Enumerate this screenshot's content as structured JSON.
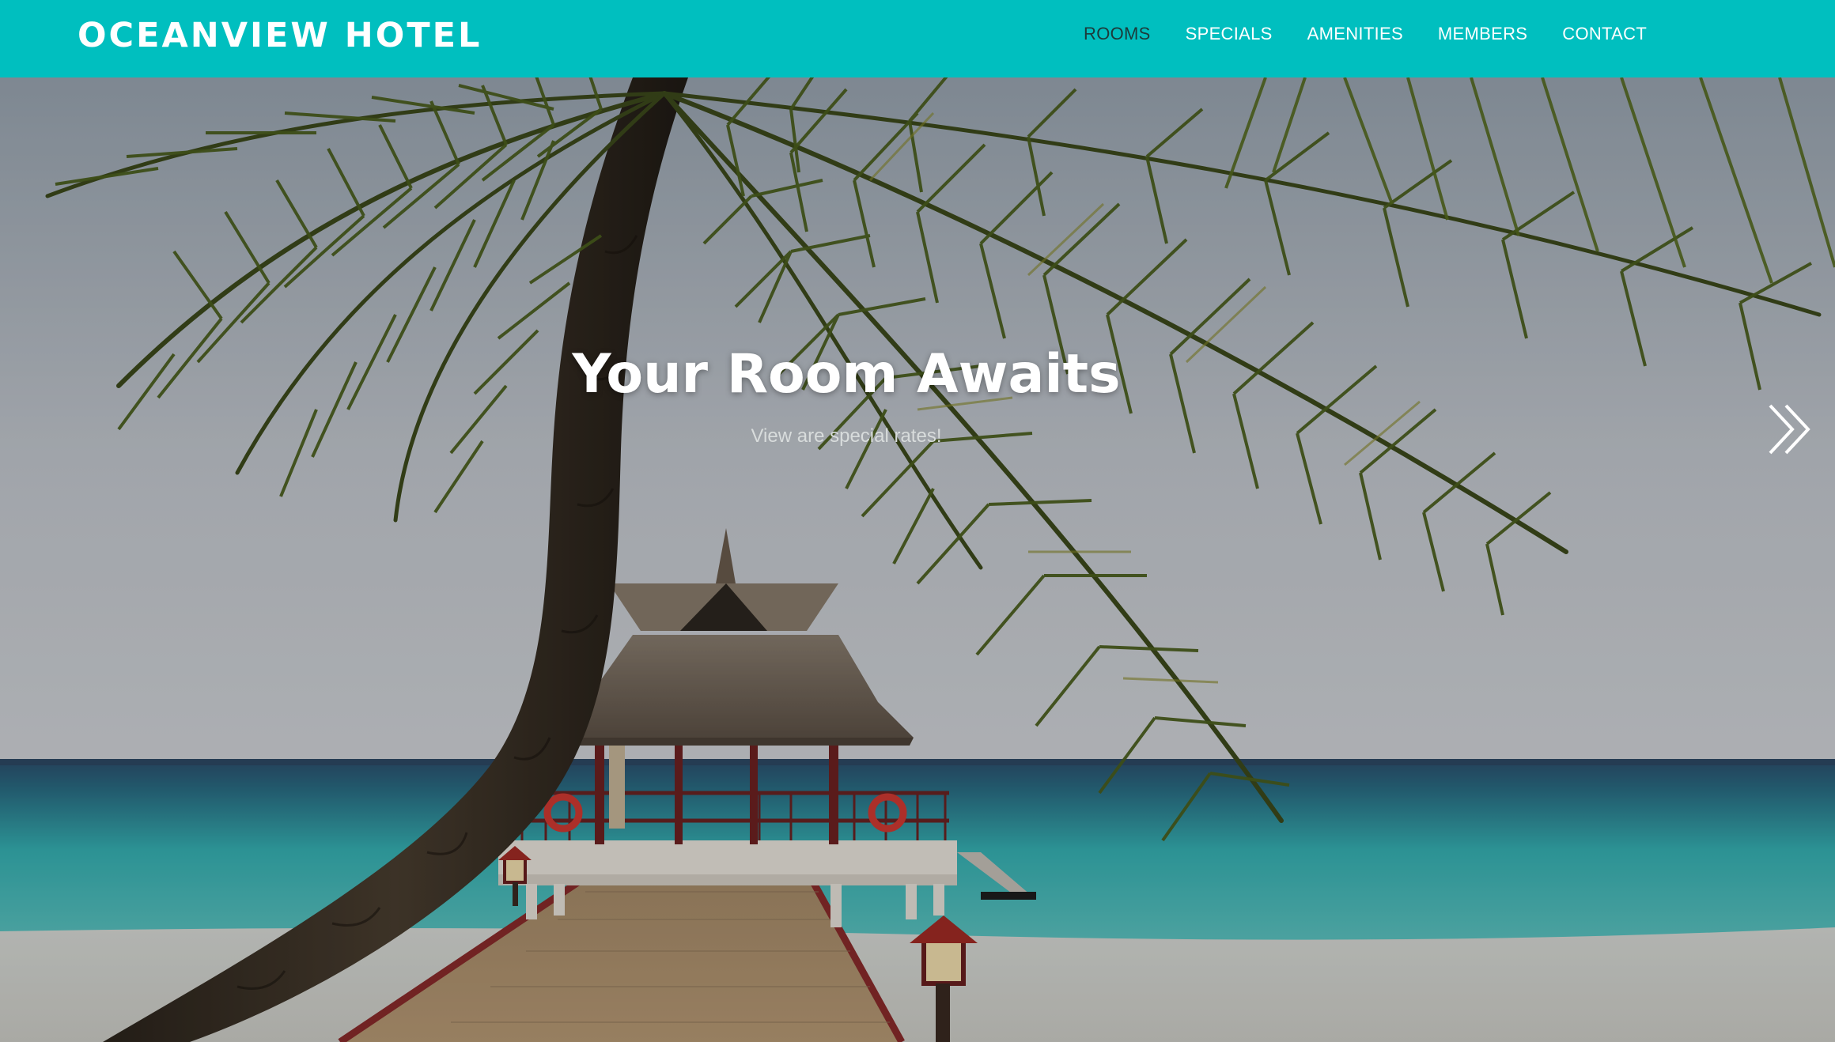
{
  "header": {
    "brand": "OCEANVIEW HOTEL",
    "nav": [
      {
        "label": "ROOMS",
        "active": true
      },
      {
        "label": "SPECIALS",
        "active": false
      },
      {
        "label": "AMENITIES",
        "active": false
      },
      {
        "label": "MEMBERS",
        "active": false
      },
      {
        "label": "CONTACT",
        "active": false
      }
    ]
  },
  "hero": {
    "title": "Your Room Awaits",
    "subtitle": "View are special rates!",
    "next_icon": "double-chevron-right-icon"
  },
  "colors": {
    "nav_background": "#00bfbf",
    "nav_text": "#ffffff",
    "nav_active_text": "#1c3a3a"
  }
}
